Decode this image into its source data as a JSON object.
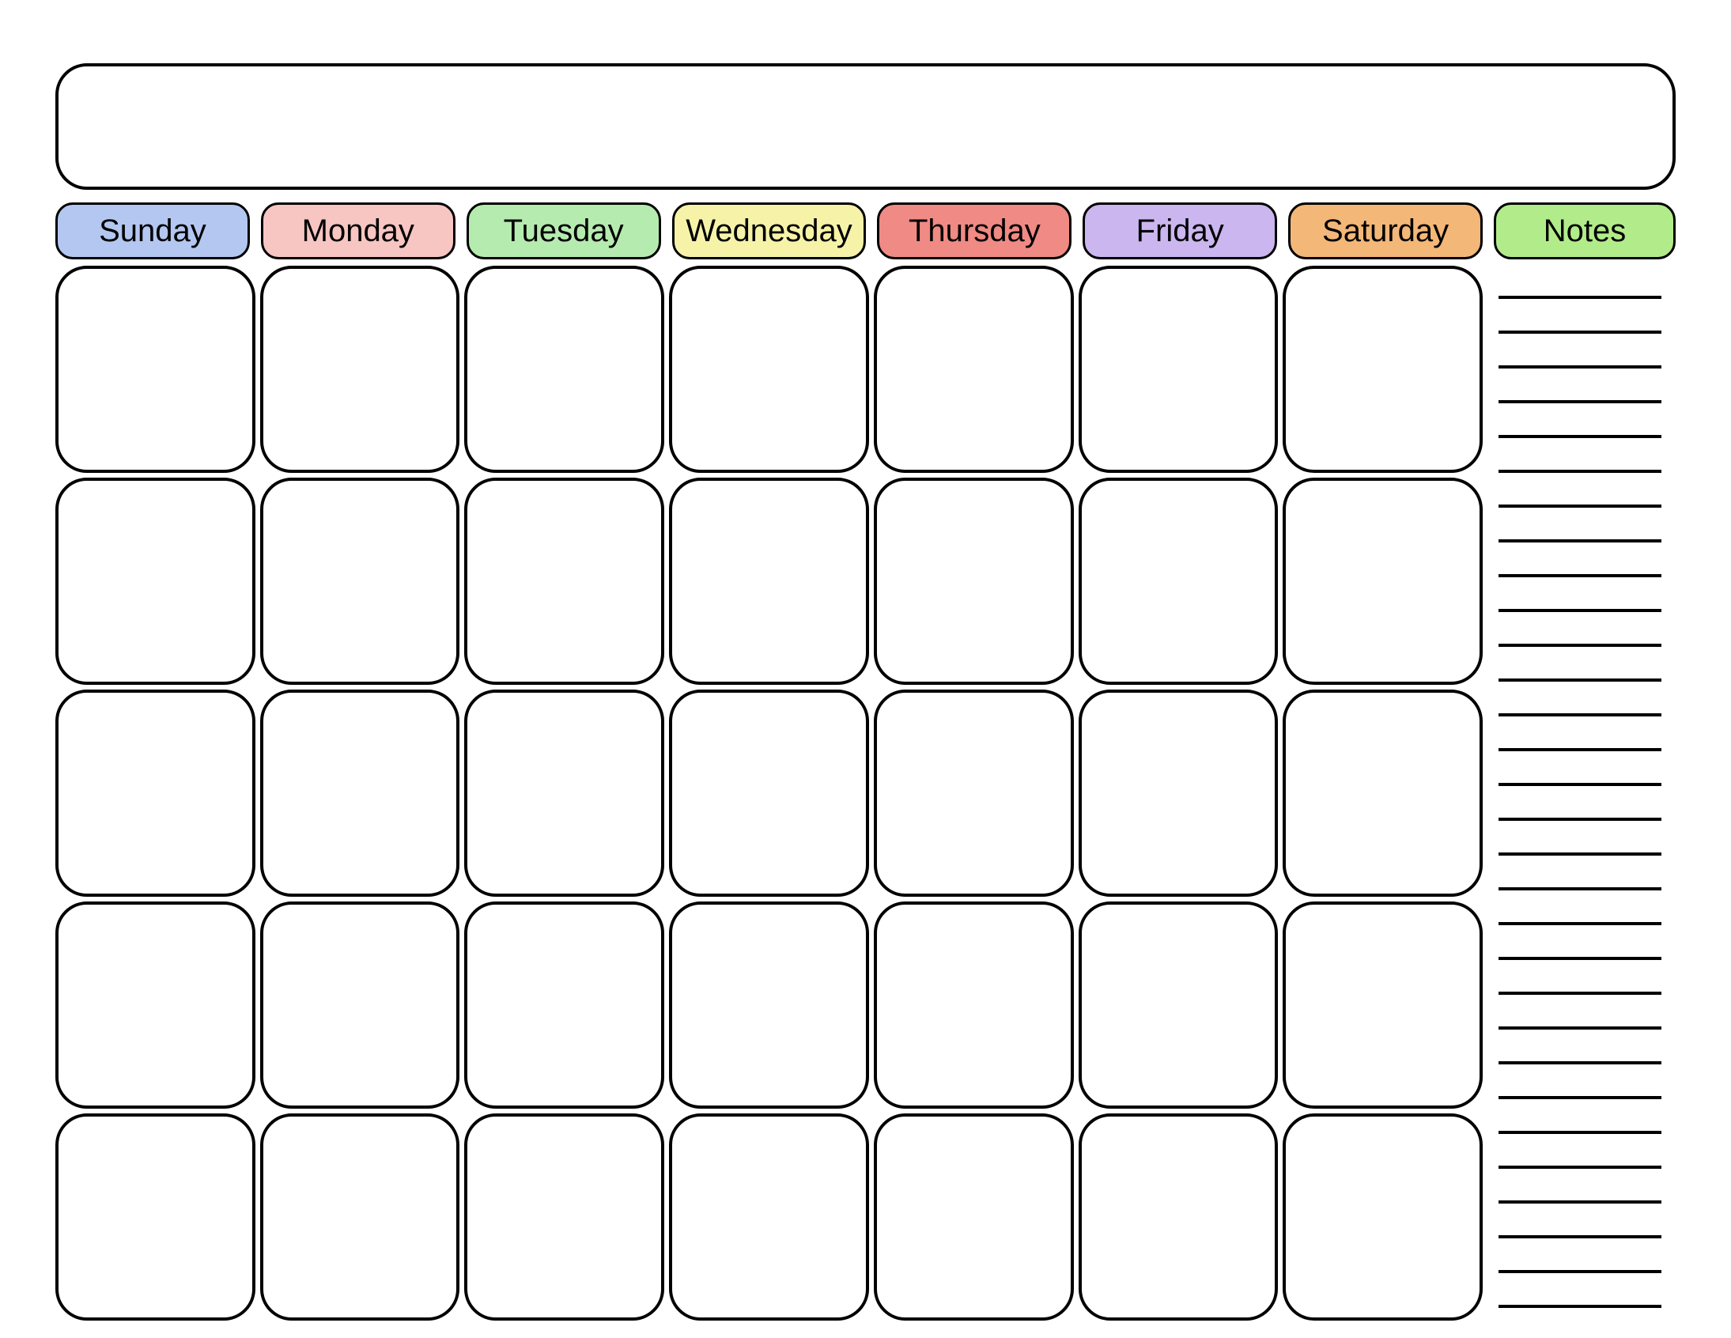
{
  "days": [
    {
      "label": "Sunday",
      "color": "#b4c7f0"
    },
    {
      "label": "Monday",
      "color": "#f7c6c2"
    },
    {
      "label": "Tuesday",
      "color": "#b6ebb0"
    },
    {
      "label": "Wednesday",
      "color": "#f6f3a9"
    },
    {
      "label": "Thursday",
      "color": "#f08a84"
    },
    {
      "label": "Friday",
      "color": "#cbb6ef"
    },
    {
      "label": "Saturday",
      "color": "#f3b778"
    }
  ],
  "notes": {
    "label": "Notes",
    "color": "#b2ec8a",
    "lines": 30
  },
  "weeks": 5
}
